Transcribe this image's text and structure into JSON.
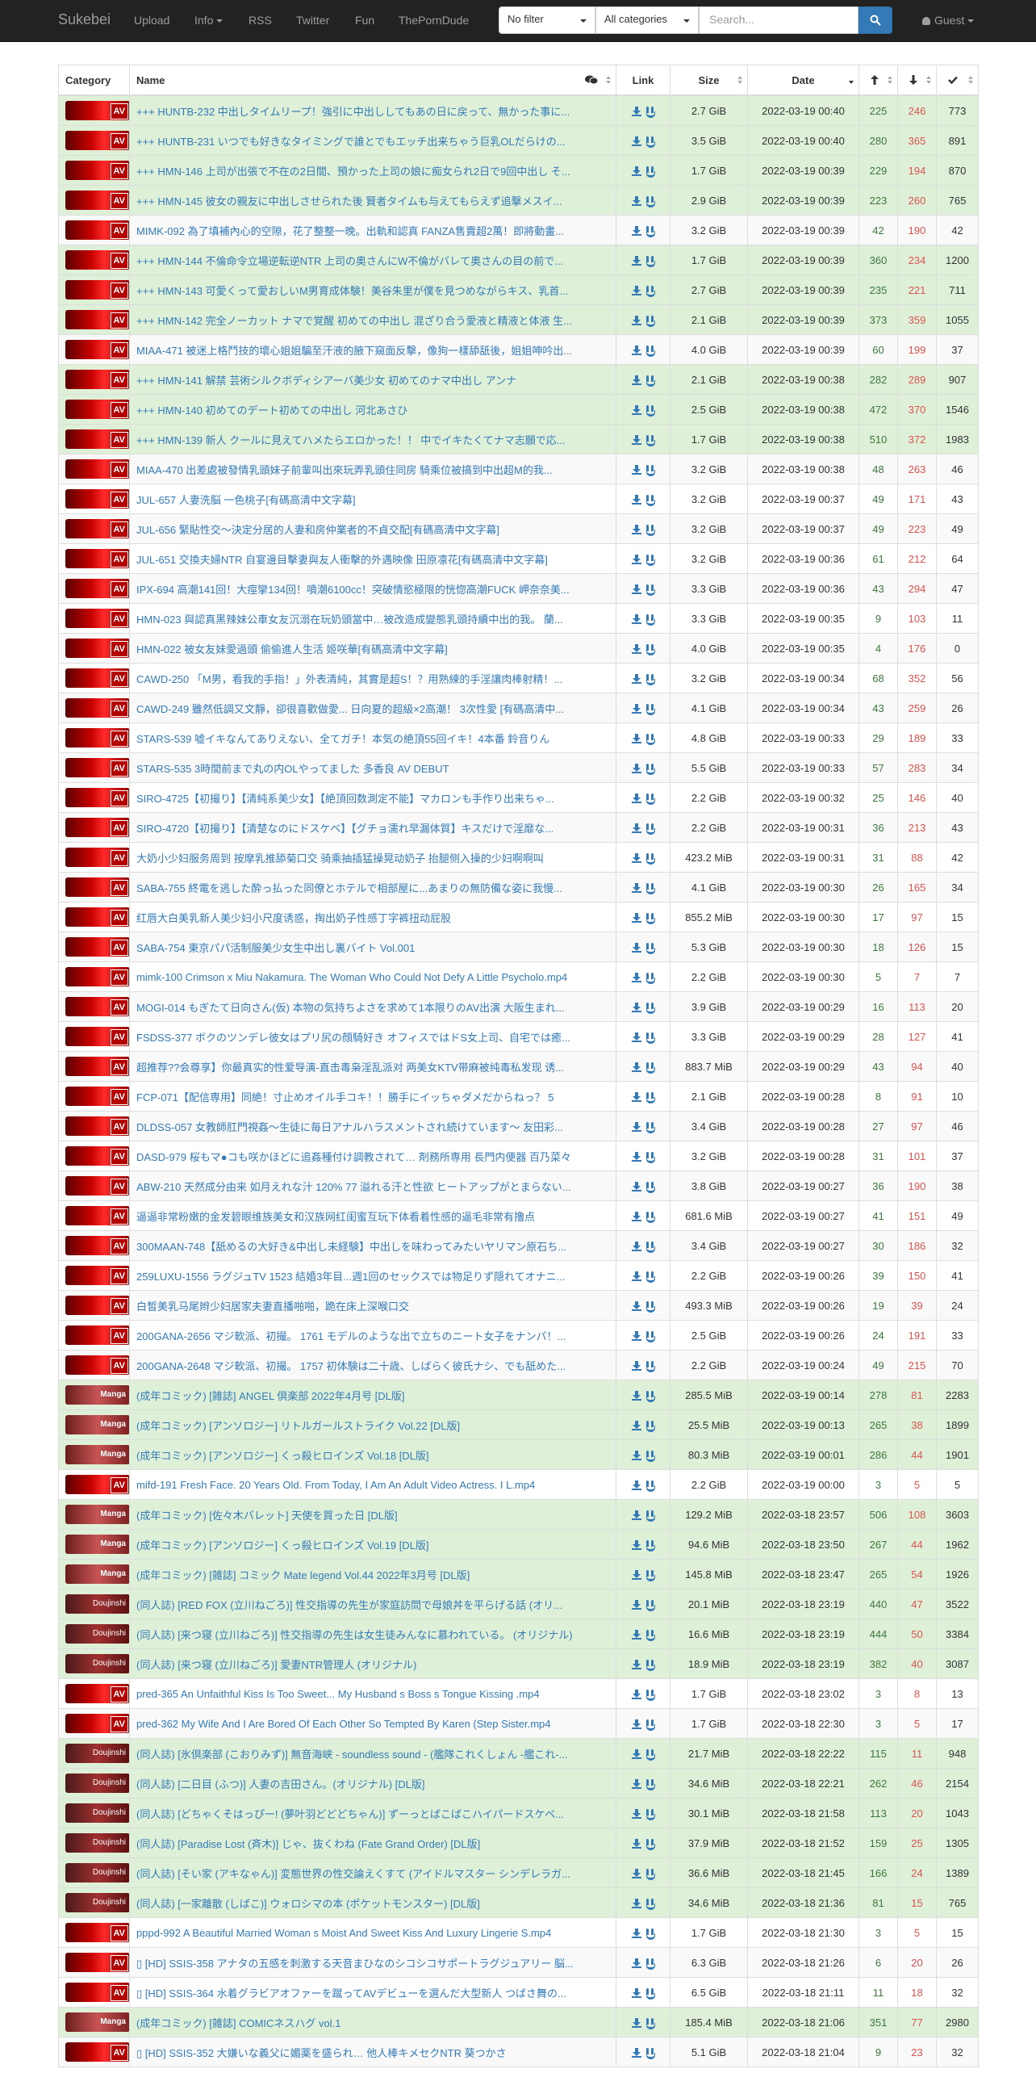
{
  "navbar": {
    "brand": "Sukebei",
    "links": [
      "Upload",
      "Info",
      "RSS",
      "Twitter",
      "Fun",
      "ThePornDude"
    ],
    "filter": "No filter",
    "category": "All categories",
    "search_placeholder": "Search...",
    "user": "Guest"
  },
  "table": {
    "headers": {
      "category": "Category",
      "name": "Name",
      "link": "Link",
      "size": "Size",
      "date": "Date"
    },
    "rows": [
      {
        "cat": "AV",
        "name": "+++ HUNTB-232 中出しタイムリープ！強引に中出ししてもあの日に戻って、無かった事に...",
        "size": "2.7 GiB",
        "date": "2022-03-19 00:40",
        "se": "225",
        "le": "246",
        "dl": "773",
        "tr": "success"
      },
      {
        "cat": "AV",
        "name": "+++ HUNTB-231 いつでも好きなタイミングで誰とでもエッチ出来ちゃう巨乳OLだらけの...",
        "size": "3.5 GiB",
        "date": "2022-03-19 00:40",
        "se": "280",
        "le": "365",
        "dl": "891",
        "tr": "success"
      },
      {
        "cat": "AV",
        "name": "+++ HMN-146 上司が出張で不在の2日間、預かった上司の娘に痴女られ2日で9回中出し そ...",
        "size": "1.7 GiB",
        "date": "2022-03-19 00:39",
        "se": "229",
        "le": "194",
        "dl": "870",
        "tr": "success"
      },
      {
        "cat": "AV",
        "name": "+++ HMN-145 彼女の親友に中出しさせられた後 賢者タイムも与えてもらえず追撃メスイ...",
        "size": "2.9 GiB",
        "date": "2022-03-19 00:39",
        "se": "223",
        "le": "260",
        "dl": "765",
        "tr": "success"
      },
      {
        "cat": "AV",
        "name": "MIMK-092 為了填補內心的空隙，花了整整一晚。出軌和認真 FANZA售賣超2萬！即將動畫...",
        "size": "3.2 GiB",
        "date": "2022-03-19 00:39",
        "se": "42",
        "le": "190",
        "dl": "42",
        "tr": "plain"
      },
      {
        "cat": "AV",
        "name": "+++ HMN-144 不倫命令立場逆転逆NTR 上司の奥さんにW不倫がバレて奥さんの目の前で...",
        "size": "1.7 GiB",
        "date": "2022-03-19 00:39",
        "se": "360",
        "le": "234",
        "dl": "1200",
        "tr": "success"
      },
      {
        "cat": "AV",
        "name": "+++ HMN-143 可愛くって愛おしいM男育成体験！美谷朱里が僕を見つめながらキス、乳首...",
        "size": "2.7 GiB",
        "date": "2022-03-19 00:39",
        "se": "235",
        "le": "221",
        "dl": "711",
        "tr": "success"
      },
      {
        "cat": "AV",
        "name": "+++ HMN-142 完全ノーカット ナマで覚醒 初めての中出し 混ざり合う愛液と精液と体液 生...",
        "size": "2.1 GiB",
        "date": "2022-03-19 00:39",
        "se": "373",
        "le": "359",
        "dl": "1055",
        "tr": "success"
      },
      {
        "cat": "AV",
        "name": "MIAA-471 被迷上格鬥技的壞心姐姐騙至汗液的腋下窺面反擊，像狗一樣舔舐後，姐姐呻吟出...",
        "size": "4.0 GiB",
        "date": "2022-03-19 00:39",
        "se": "60",
        "le": "199",
        "dl": "37",
        "tr": "plain"
      },
      {
        "cat": "AV",
        "name": "+++ HMN-141 解禁 芸術シルクボディシアーバ美少女 初めてのナマ中出し アンナ",
        "size": "2.1 GiB",
        "date": "2022-03-19 00:38",
        "se": "282",
        "le": "289",
        "dl": "907",
        "tr": "success"
      },
      {
        "cat": "AV",
        "name": "+++ HMN-140 初めてのデート初めての中出し 河北あさひ",
        "size": "2.5 GiB",
        "date": "2022-03-19 00:38",
        "se": "472",
        "le": "370",
        "dl": "1546",
        "tr": "success"
      },
      {
        "cat": "AV",
        "name": "+++ HMN-139 新人 クールに見えてハメたらエロかった！！ 中でイキたくてナマ志願で応...",
        "size": "1.7 GiB",
        "date": "2022-03-19 00:38",
        "se": "510",
        "le": "372",
        "dl": "1983",
        "tr": "success"
      },
      {
        "cat": "AV",
        "name": "MIAA-470 出差處被發情乳頭妹子前輩叫出來玩弄乳頭住同房 騎乘位被搞到中出超M的我...",
        "size": "3.2 GiB",
        "date": "2022-03-19 00:38",
        "se": "48",
        "le": "263",
        "dl": "46",
        "tr": "plain"
      },
      {
        "cat": "AV",
        "name": "JUL-657 人妻洗脳 一色桃子[有碼高清中文字幕]",
        "size": "3.2 GiB",
        "date": "2022-03-19 00:37",
        "se": "49",
        "le": "171",
        "dl": "43",
        "tr": "plain2"
      },
      {
        "cat": "AV",
        "name": "JUL-656 緊貼性交～決定分居的人妻和房仲業者的不貞交配[有碼高清中文字幕]",
        "size": "3.2 GiB",
        "date": "2022-03-19 00:37",
        "se": "49",
        "le": "223",
        "dl": "49",
        "tr": "plain"
      },
      {
        "cat": "AV",
        "name": "JUL-651 交換夫婦NTR 自宴邊目擊妻與友人衝擊的外遇映像 田原凛花[有碼高清中文字幕]",
        "size": "3.2 GiB",
        "date": "2022-03-19 00:36",
        "se": "61",
        "le": "212",
        "dl": "64",
        "tr": "plain2"
      },
      {
        "cat": "AV",
        "name": "IPX-694 高潮141回！大痙攣134回！噴潮6100cc！突破情慾極限的恍惚高潮FUCK 岬奈奈美...",
        "size": "3.3 GiB",
        "date": "2022-03-19 00:36",
        "se": "43",
        "le": "294",
        "dl": "47",
        "tr": "plain"
      },
      {
        "cat": "AV",
        "name": "HMN-023 與認真黑辣妹公車女友沉溺在玩奶頭當中…被改造成變態乳頭持續中出的我。 蘭...",
        "size": "3.3 GiB",
        "date": "2022-03-19 00:35",
        "se": "9",
        "le": "103",
        "dl": "11",
        "tr": "plain2"
      },
      {
        "cat": "AV",
        "name": "HMN-022 被女友妹愛過頭 偷偷進人生活 姬咲華[有碼高清中文字幕]",
        "size": "4.0 GiB",
        "date": "2022-03-19 00:35",
        "se": "4",
        "le": "176",
        "dl": "0",
        "tr": "plain"
      },
      {
        "cat": "AV",
        "name": "CAWD-250 「M男，看我的手指！」外表清純，其實是超S！？用熟練的手淫讓肉棒射精！...",
        "size": "3.2 GiB",
        "date": "2022-03-19 00:34",
        "se": "68",
        "le": "352",
        "dl": "56",
        "tr": "plain2"
      },
      {
        "cat": "AV",
        "name": "CAWD-249 雖然低調又文靜，卻很喜歡做愛... 日向夏的超級×2高潮！ 3次性愛 [有碼高清中...",
        "size": "4.1 GiB",
        "date": "2022-03-19 00:34",
        "se": "43",
        "le": "259",
        "dl": "26",
        "tr": "plain"
      },
      {
        "cat": "AV",
        "name": "STARS-539 嘘イキなんてありえない、全てガチ！本気の絶頂55回イキ！4本番 鈴音りん",
        "size": "4.8 GiB",
        "date": "2022-03-19 00:33",
        "se": "29",
        "le": "189",
        "dl": "33",
        "tr": "plain2"
      },
      {
        "cat": "AV",
        "name": "STARS-535 3時間前まで丸の内OLやってました 多香良 AV DEBUT",
        "size": "5.5 GiB",
        "date": "2022-03-19 00:33",
        "se": "57",
        "le": "283",
        "dl": "34",
        "tr": "plain"
      },
      {
        "cat": "AV",
        "name": "SIRO-4725【初撮り】【清純系美少女】【絶頂回数測定不能】マカロンも手作り出来ちゃ...",
        "size": "2.2 GiB",
        "date": "2022-03-19 00:32",
        "se": "25",
        "le": "146",
        "dl": "40",
        "tr": "plain2"
      },
      {
        "cat": "AV",
        "name": "SIRO-4720【初撮り】【清楚なのにドスケベ】【グチョ濡れ早漏体質】キスだけで淫靡な...",
        "size": "2.2 GiB",
        "date": "2022-03-19 00:31",
        "se": "36",
        "le": "213",
        "dl": "43",
        "tr": "plain"
      },
      {
        "cat": "AV",
        "name": "大奶小少妇服务周到 按摩乳推舔菊口交 骑乘抽插猛操晃动奶子 抬腿侧入操的少妇啊啊叫",
        "size": "423.2 MiB",
        "date": "2022-03-19 00:31",
        "se": "31",
        "le": "88",
        "dl": "42",
        "tr": "plain2"
      },
      {
        "cat": "AV",
        "name": "SABA-755 終電を逃した酔っ払った同僚とホテルで相部屋に...あまりの無防備な姿に我慢...",
        "size": "4.1 GiB",
        "date": "2022-03-19 00:30",
        "se": "26",
        "le": "165",
        "dl": "34",
        "tr": "plain"
      },
      {
        "cat": "AV",
        "name": "红唇大白美乳新人美少妇小尺度诱惑，掏出奶子性感丁字裤扭动屁股",
        "size": "855.2 MiB",
        "date": "2022-03-19 00:30",
        "se": "17",
        "le": "97",
        "dl": "15",
        "tr": "plain2"
      },
      {
        "cat": "AV",
        "name": "SABA-754 東京パパ活制服美少女生中出し裏バイト Vol.001",
        "size": "5.3 GiB",
        "date": "2022-03-19 00:30",
        "se": "18",
        "le": "126",
        "dl": "15",
        "tr": "plain"
      },
      {
        "cat": "AV",
        "name": "mimk-100 Crimson x Miu Nakamura. The Woman Who Could Not Defy A Little Psycholo.mp4",
        "size": "2.2 GiB",
        "date": "2022-03-19 00:30",
        "se": "5",
        "le": "7",
        "dl": "7",
        "tr": "plain2"
      },
      {
        "cat": "AV",
        "name": "MOGI-014 もぎたて日向さん(仮) 本物の気持ちよさを求めて1本限りのAV出演 大阪生まれ...",
        "size": "3.9 GiB",
        "date": "2022-03-19 00:29",
        "se": "16",
        "le": "113",
        "dl": "20",
        "tr": "plain"
      },
      {
        "cat": "AV",
        "name": "FSDSS-377 ボクのツンデレ彼女はプリ尻の顔騎好き オフィスではドS女上司、自宅では癒...",
        "size": "3.3 GiB",
        "date": "2022-03-19 00:29",
        "se": "28",
        "le": "127",
        "dl": "41",
        "tr": "plain2"
      },
      {
        "cat": "AV",
        "name": "超推荐??会尊享】你最真实的性爱导演-直击毒枭淫乱派对 两美女KTV带麻被纯毒私发现 诱...",
        "size": "883.7 MiB",
        "date": "2022-03-19 00:29",
        "se": "43",
        "le": "94",
        "dl": "40",
        "tr": "plain"
      },
      {
        "cat": "AV",
        "name": "FCP-071【配信専用】同絶！寸止めオイル手コキ！！勝手にイッちゃダメだからねっ？ 5",
        "size": "2.1 GiB",
        "date": "2022-03-19 00:28",
        "se": "8",
        "le": "91",
        "dl": "10",
        "tr": "plain2"
      },
      {
        "cat": "AV",
        "name": "DLDSS-057 女教師肛門視姦～生徒に毎日アナルハラスメントされ続けています～ 友田彩...",
        "size": "3.4 GiB",
        "date": "2022-03-19 00:28",
        "se": "27",
        "le": "97",
        "dl": "46",
        "tr": "plain"
      },
      {
        "cat": "AV",
        "name": "DASD-979 桜もマ●コも咲かほどに追姦種付け調教されて… 剤務所専用 長門内便器 百乃菜々",
        "size": "3.2 GiB",
        "date": "2022-03-19 00:28",
        "se": "31",
        "le": "101",
        "dl": "37",
        "tr": "plain2"
      },
      {
        "cat": "AV",
        "name": "ABW-210 天然成分由来 如月えれな汁 120% 77 溢れる汗と性欲 ヒートアップがとまらない...",
        "size": "3.8 GiB",
        "date": "2022-03-19 00:27",
        "se": "36",
        "le": "190",
        "dl": "38",
        "tr": "plain"
      },
      {
        "cat": "AV",
        "name": "逼逼非常粉嫩的金发碧眼维族美女和汉族网红闺蜜互玩下体看着性感的逼毛非常有撸点",
        "size": "681.6 MiB",
        "date": "2022-03-19 00:27",
        "se": "41",
        "le": "151",
        "dl": "49",
        "tr": "plain2"
      },
      {
        "cat": "AV",
        "name": "300MAAN-748【舐めるの大好き&中出し未経験】中出しを味わってみたいヤリマン原石ち...",
        "size": "3.4 GiB",
        "date": "2022-03-19 00:27",
        "se": "30",
        "le": "186",
        "dl": "32",
        "tr": "plain"
      },
      {
        "cat": "AV",
        "name": "259LUXU-1556 ラグジュTV 1523 結婚3年目...週1回のセックスでは物足りず隠れてオナニ...",
        "size": "2.2 GiB",
        "date": "2022-03-19 00:26",
        "se": "39",
        "le": "150",
        "dl": "41",
        "tr": "plain2"
      },
      {
        "cat": "AV",
        "name": "白皙美乳马尾辫少妇居家夫妻直播啪啪，跪在床上深喉口交",
        "size": "493.3 MiB",
        "date": "2022-03-19 00:26",
        "se": "19",
        "le": "39",
        "dl": "24",
        "tr": "plain"
      },
      {
        "cat": "AV",
        "name": "200GANA-2656 マジ軟派、初撮。 1761 モデルのような出で立ちのニート女子をナンパ！...",
        "size": "2.5 GiB",
        "date": "2022-03-19 00:26",
        "se": "24",
        "le": "191",
        "dl": "33",
        "tr": "plain2"
      },
      {
        "cat": "AV",
        "name": "200GANA-2648 マジ軟派、初撮。 1757 初体験は二十歳、しばらく彼氏ナシ、でも舐めた...",
        "size": "2.2 GiB",
        "date": "2022-03-19 00:24",
        "se": "49",
        "le": "215",
        "dl": "70",
        "tr": "plain"
      },
      {
        "cat": "Manga",
        "name": "(成年コミック) [雑誌] ANGEL 倶楽部 2022年4月号 [DL版]",
        "size": "285.5 MiB",
        "date": "2022-03-19 00:14",
        "se": "278",
        "le": "81",
        "dl": "2283",
        "tr": "success"
      },
      {
        "cat": "Manga",
        "name": "(成年コミック) [アンソロジー] リトルガールストライク Vol.22 [DL版]",
        "size": "25.5 MiB",
        "date": "2022-03-19 00:13",
        "se": "265",
        "le": "38",
        "dl": "1899",
        "tr": "success"
      },
      {
        "cat": "Manga",
        "name": "(成年コミック) [アンソロジー] くっ殺ヒロインズ Vol.18 [DL版]",
        "size": "80.3 MiB",
        "date": "2022-03-19 00:01",
        "se": "286",
        "le": "44",
        "dl": "1901",
        "tr": "success"
      },
      {
        "cat": "AV",
        "name": "mifd-191 Fresh Face. 20 Years Old. From Today, I Am An Adult Video Actress. I L.mp4",
        "size": "2.2 GiB",
        "date": "2022-03-19 00:00",
        "se": "3",
        "le": "5",
        "dl": "5",
        "tr": "plain2"
      },
      {
        "cat": "Manga",
        "name": "(成年コミック) [佐々木バレット] 天使を買った日 [DL版]",
        "size": "129.2 MiB",
        "date": "2022-03-18 23:57",
        "se": "506",
        "le": "108",
        "dl": "3603",
        "tr": "success"
      },
      {
        "cat": "Manga",
        "name": "(成年コミック) [アンソロジー] くっ殺ヒロインズ Vol.19 [DL版]",
        "size": "94.6 MiB",
        "date": "2022-03-18 23:50",
        "se": "267",
        "le": "44",
        "dl": "1962",
        "tr": "success"
      },
      {
        "cat": "Manga",
        "name": "(成年コミック) [雑誌] コミック Mate legend Vol.44 2022年3月号 [DL版]",
        "size": "145.8 MiB",
        "date": "2022-03-18 23:47",
        "se": "265",
        "le": "54",
        "dl": "1926",
        "tr": "success"
      },
      {
        "cat": "Doujinshi",
        "name": "(同人誌) [RED FOX (立川ねごろ)] 性交指導の先生が家庭訪問で母娘丼を平らげる話 (オリ...",
        "size": "20.1 MiB",
        "date": "2022-03-18 23:19",
        "se": "440",
        "le": "47",
        "dl": "3522",
        "tr": "success"
      },
      {
        "cat": "Doujinshi",
        "name": "(同人誌) [来つ寝 (立川ねごろ)] 性交指導の先生は女生徒みんなに慕われている。 (オリジナル)",
        "size": "16.6 MiB",
        "date": "2022-03-18 23:19",
        "se": "444",
        "le": "50",
        "dl": "3384",
        "tr": "success"
      },
      {
        "cat": "Doujinshi",
        "name": "(同人誌) [来つ寝 (立川ねごろ)] 愛妻NTR管理人 (オリジナル)",
        "size": "18.9 MiB",
        "date": "2022-03-18 23:19",
        "se": "382",
        "le": "40",
        "dl": "3087",
        "tr": "success"
      },
      {
        "cat": "AV",
        "name": "pred-365 An Unfaithful Kiss Is Too Sweet... My Husband s Boss s Tongue Kissing .mp4",
        "size": "1.7 GiB",
        "date": "2022-03-18 23:02",
        "se": "3",
        "le": "8",
        "dl": "13",
        "tr": "plain2"
      },
      {
        "cat": "AV",
        "name": "pred-362 My Wife And I Are Bored Of Each Other So Tempted By Karen (Step Sister.mp4",
        "size": "1.7 GiB",
        "date": "2022-03-18 22:30",
        "se": "3",
        "le": "5",
        "dl": "17",
        "tr": "plain"
      },
      {
        "cat": "Doujinshi",
        "name": "(同人誌) [氷倶楽部 (こおりみず)] 無音海峡 - soundless sound - (艦隊これくしょん -艦これ-...",
        "size": "21.7 MiB",
        "date": "2022-03-18 22:22",
        "se": "115",
        "le": "11",
        "dl": "948",
        "tr": "success"
      },
      {
        "cat": "Doujinshi",
        "name": "(同人誌) [二日目 (ふつ)] 人妻の吉田さん。(オリジナル) [DL版]",
        "size": "34.6 MiB",
        "date": "2022-03-18 22:21",
        "se": "262",
        "le": "46",
        "dl": "2154",
        "tr": "success"
      },
      {
        "cat": "Doujinshi",
        "name": "(同人誌) [どちゃくそはっぴー! (夢叶羽どどどちゃん)] ずーっとばこばこハイパードスケベ...",
        "size": "30.1 MiB",
        "date": "2022-03-18 21:58",
        "se": "113",
        "le": "20",
        "dl": "1043",
        "tr": "success"
      },
      {
        "cat": "Doujinshi",
        "name": "(同人誌) [Paradise Lost (斉木)] じゃ、抜くわね (Fate Grand Order) [DL版]",
        "size": "37.9 MiB",
        "date": "2022-03-18 21:52",
        "se": "159",
        "le": "25",
        "dl": "1305",
        "tr": "success"
      },
      {
        "cat": "Doujinshi",
        "name": "(同人誌) [そい家 (アキなゃん)] 変態世界の性交論えくすて (アイドルマスター シンデレラガ...",
        "size": "36.6 MiB",
        "date": "2022-03-18 21:45",
        "se": "166",
        "le": "24",
        "dl": "1389",
        "tr": "success"
      },
      {
        "cat": "Doujinshi",
        "name": "(同人誌) [一家離散 (しばこ)] ウォロシマの本 (ポケットモンスター) [DL版]",
        "size": "34.6 MiB",
        "date": "2022-03-18 21:36",
        "se": "81",
        "le": "15",
        "dl": "765",
        "tr": "success"
      },
      {
        "cat": "AV",
        "name": "pppd-992 A Beautiful Married Woman s Moist And Sweet Kiss And Luxury Lingerie S.mp4",
        "size": "1.7 GiB",
        "date": "2022-03-18 21:30",
        "se": "3",
        "le": "5",
        "dl": "15",
        "tr": "plain2"
      },
      {
        "cat": "AV",
        "name": "▯ [HD] SSIS-358 アナタの五感を刺激する天音まひなのシコシコサポートラグジュアリー 脳...",
        "size": "6.3 GiB",
        "date": "2022-03-18 21:26",
        "se": "6",
        "le": "20",
        "dl": "26",
        "tr": "plain"
      },
      {
        "cat": "AV",
        "name": "▯ [HD] SSIS-364 水着グラビアオファーを蹴ってAVデビューを選んだ大型新人 つばさ舞の...",
        "size": "6.5 GiB",
        "date": "2022-03-18 21:11",
        "se": "11",
        "le": "18",
        "dl": "32",
        "tr": "plain2"
      },
      {
        "cat": "Manga",
        "name": "(成年コミック) [雑誌] COMICネスハグ vol.1",
        "size": "185.4 MiB",
        "date": "2022-03-18 21:06",
        "se": "351",
        "le": "77",
        "dl": "2980",
        "tr": "success"
      },
      {
        "cat": "AV",
        "name": "▯ [HD] SSIS-352 大嫌いな義父に媚薬を盛られ… 他人棒キメセクNTR 葵つかさ",
        "size": "5.1 GiB",
        "date": "2022-03-18 21:04",
        "se": "9",
        "le": "23",
        "dl": "32",
        "tr": "plain"
      }
    ]
  }
}
